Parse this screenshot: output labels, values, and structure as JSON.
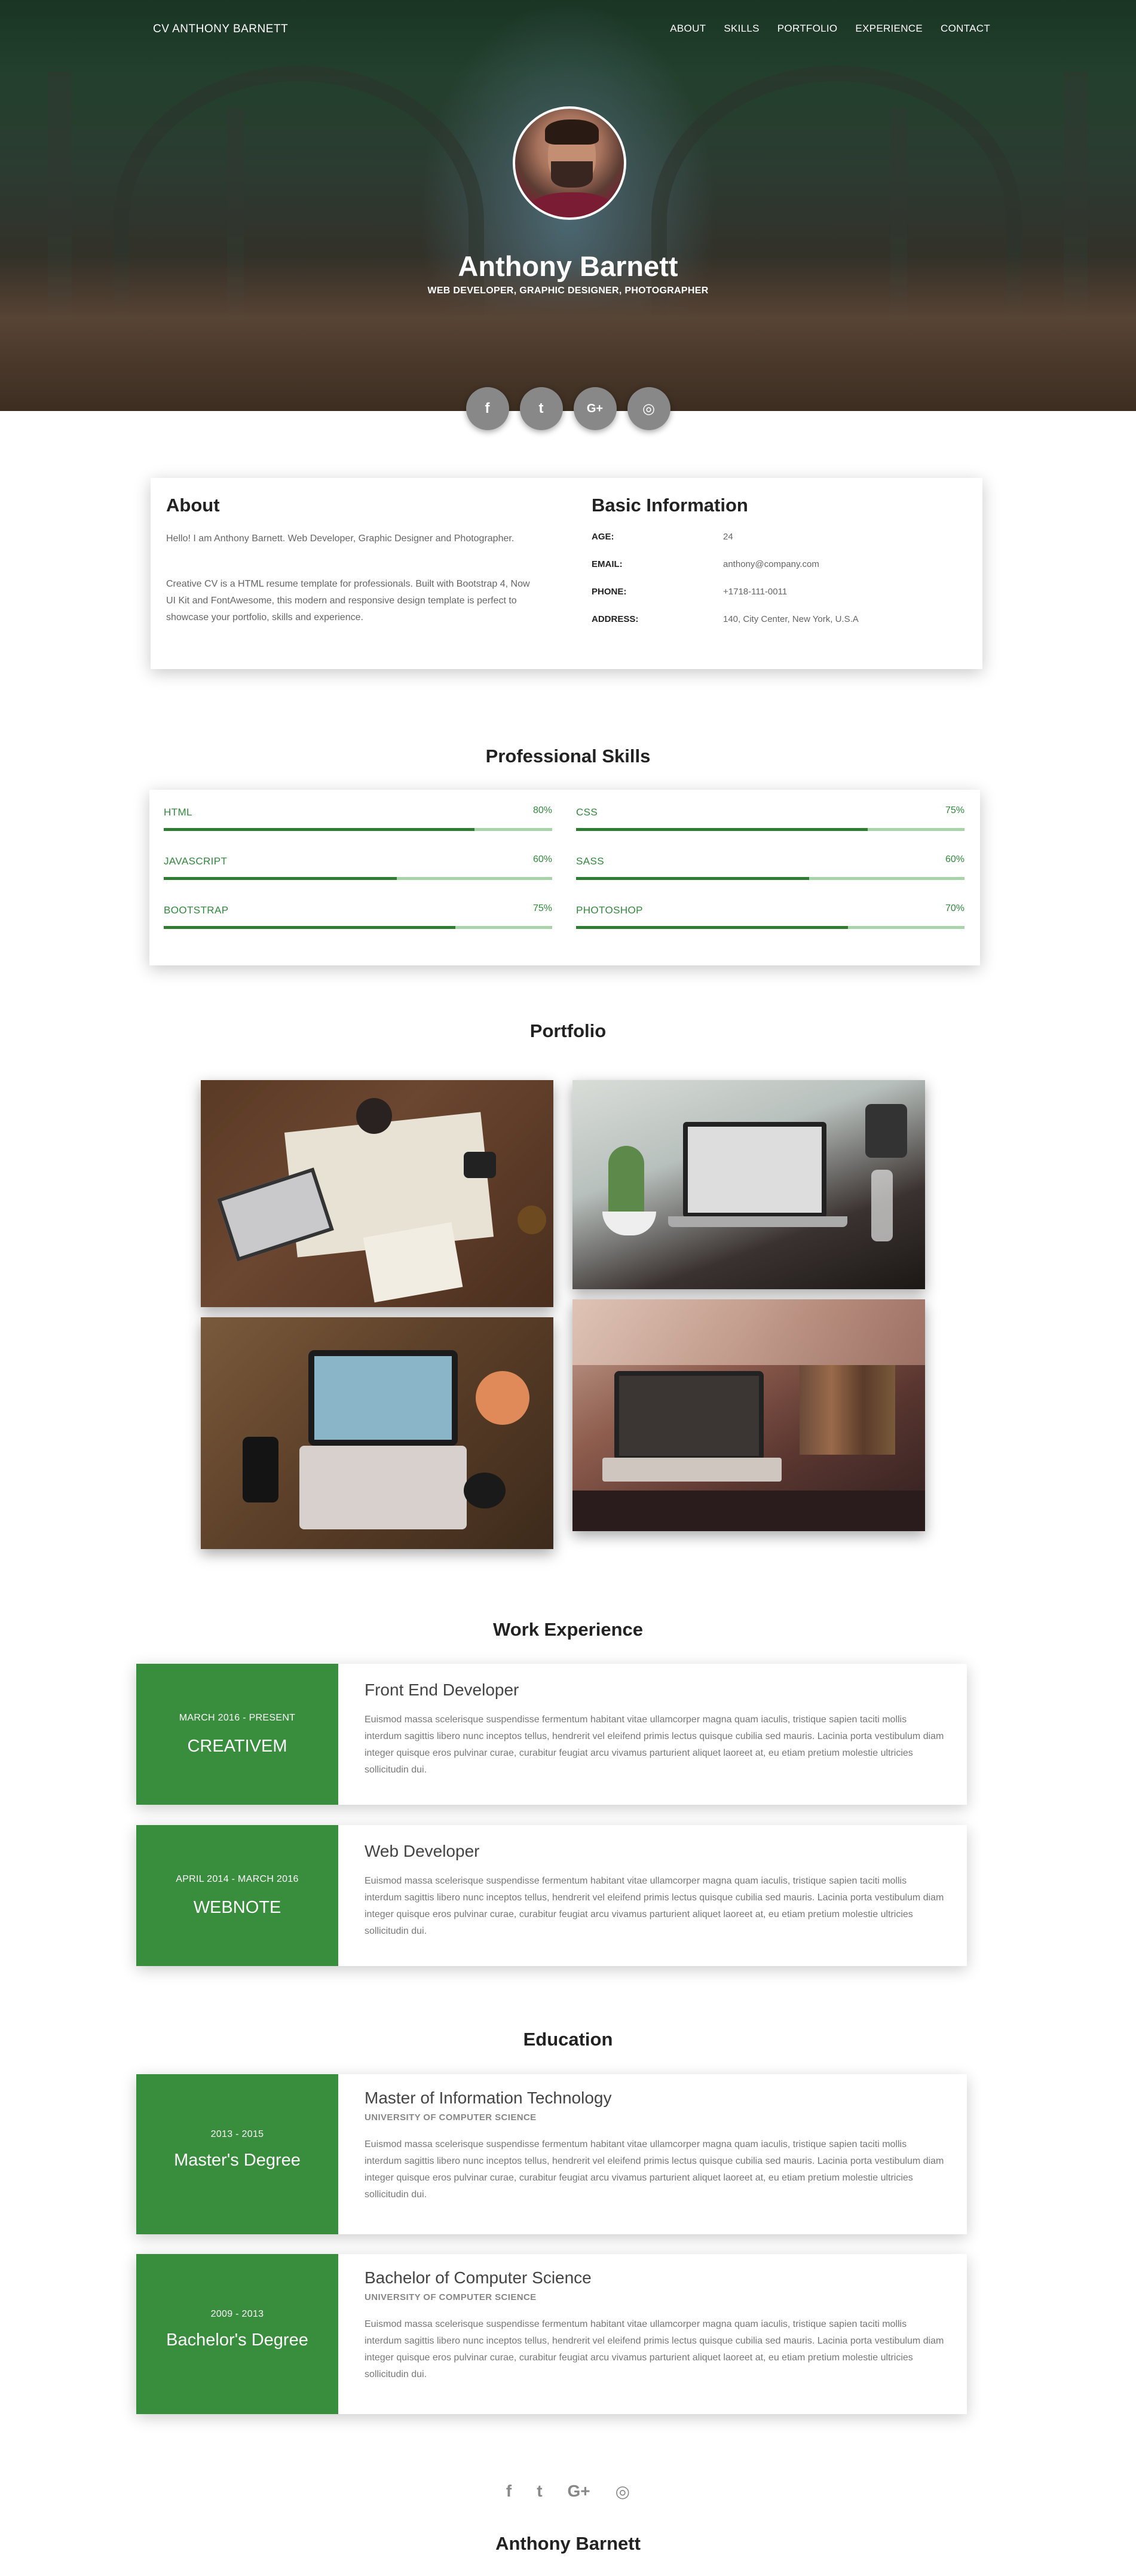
{
  "nav": {
    "brand": "CV ANTHONY BARNETT",
    "links": [
      "ABOUT",
      "SKILLS",
      "PORTFOLIO",
      "EXPERIENCE",
      "CONTACT"
    ]
  },
  "hero": {
    "name": "Anthony Barnett",
    "role": "WEB DEVELOPER, GRAPHIC DESIGNER, PHOTOGRAPHER",
    "social": [
      {
        "icon": "facebook-icon",
        "glyph": "f"
      },
      {
        "icon": "twitter-icon",
        "glyph": "t"
      },
      {
        "icon": "google-plus-icon",
        "glyph": "G+"
      },
      {
        "icon": "instagram-icon",
        "glyph": "◎"
      }
    ]
  },
  "about": {
    "title": "About",
    "p1": "Hello! I am Anthony Barnett. Web Developer, Graphic Designer and Photographer.",
    "p2": "Creative CV is a HTML resume template for professionals. Built with Bootstrap 4, Now UI Kit and FontAwesome, this modern and responsive design template is perfect to showcase your portfolio, skills and experience."
  },
  "basic": {
    "title": "Basic Information",
    "rows": [
      {
        "k": "AGE:",
        "v": "24"
      },
      {
        "k": "EMAIL:",
        "v": "anthony@company.com"
      },
      {
        "k": "PHONE:",
        "v": "+1718-111-0011"
      },
      {
        "k": "ADDRESS:",
        "v": "140, City Center, New York, U.S.A"
      }
    ]
  },
  "skills": {
    "title": "Professional Skills",
    "items": [
      {
        "name": "HTML",
        "pct": "80%",
        "value": 0.8
      },
      {
        "name": "CSS",
        "pct": "75%",
        "value": 0.75
      },
      {
        "name": "JAVASCRIPT",
        "pct": "60%",
        "value": 0.6
      },
      {
        "name": "SASS",
        "pct": "60%",
        "value": 0.6
      },
      {
        "name": "BOOTSTRAP",
        "pct": "75%",
        "value": 0.75
      },
      {
        "name": "PHOTOSHOP",
        "pct": "70%",
        "value": 0.7
      }
    ]
  },
  "portfolio": {
    "title": "Portfolio"
  },
  "experience": {
    "title": "Work Experience",
    "items": [
      {
        "date": "MARCH 2016 - PRESENT",
        "org": "CREATIVEM",
        "title": "Front End Developer",
        "desc": "Euismod massa scelerisque suspendisse fermentum habitant vitae ullamcorper magna quam iaculis, tristique sapien taciti mollis interdum sagittis libero nunc inceptos tellus, hendrerit vel eleifend primis lectus quisque cubilia sed mauris. Lacinia porta vestibulum diam integer quisque eros pulvinar curae, curabitur feugiat arcu vivamus parturient aliquet laoreet at, eu etiam pretium molestie ultricies sollicitudin dui."
      },
      {
        "date": "APRIL 2014 - MARCH 2016",
        "org": "WEBNOTE",
        "title": "Web Developer",
        "desc": "Euismod massa scelerisque suspendisse fermentum habitant vitae ullamcorper magna quam iaculis, tristique sapien taciti mollis interdum sagittis libero nunc inceptos tellus, hendrerit vel eleifend primis lectus quisque cubilia sed mauris. Lacinia porta vestibulum diam integer quisque eros pulvinar curae, curabitur feugiat arcu vivamus parturient aliquet laoreet at, eu etiam pretium molestie ultricies sollicitudin dui."
      }
    ]
  },
  "education": {
    "title": "Education",
    "items": [
      {
        "date": "2013 - 2015",
        "org": "Master's Degree",
        "title": "Master of Information Technology",
        "sub": "UNIVERSITY OF COMPUTER SCIENCE",
        "desc": "Euismod massa scelerisque suspendisse fermentum habitant vitae ullamcorper magna quam iaculis, tristique sapien taciti mollis interdum sagittis libero nunc inceptos tellus, hendrerit vel eleifend primis lectus quisque cubilia sed mauris. Lacinia porta vestibulum diam integer quisque eros pulvinar curae, curabitur feugiat arcu vivamus parturient aliquet laoreet at, eu etiam pretium molestie ultricies sollicitudin dui."
      },
      {
        "date": "2009 - 2013",
        "org": "Bachelor's Degree",
        "title": "Bachelor of Computer Science",
        "sub": "UNIVERSITY OF COMPUTER SCIENCE",
        "desc": "Euismod massa scelerisque suspendisse fermentum habitant vitae ullamcorper magna quam iaculis, tristique sapien taciti mollis interdum sagittis libero nunc inceptos tellus, hendrerit vel eleifend primis lectus quisque cubilia sed mauris. Lacinia porta vestibulum diam integer quisque eros pulvinar curae, curabitur feugiat arcu vivamus parturient aliquet laoreet at, eu etiam pretium molestie ultricies sollicitudin dui."
      }
    ]
  },
  "footer": {
    "name": "Anthony Barnett",
    "social": [
      {
        "icon": "facebook-icon",
        "glyph": "f"
      },
      {
        "icon": "twitter-icon",
        "glyph": "t"
      },
      {
        "icon": "google-plus-icon",
        "glyph": "G+"
      },
      {
        "icon": "instagram-icon",
        "glyph": "◎"
      }
    ]
  },
  "colors": {
    "accent": "#388e3c",
    "skill_text": "#2e8b3a",
    "track": "#a9d3a9"
  }
}
